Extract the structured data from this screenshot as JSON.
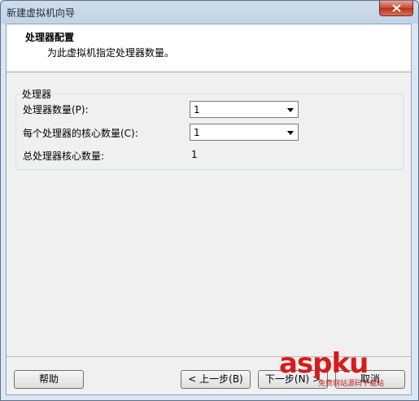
{
  "window": {
    "title": "新建虚拟机向导"
  },
  "header": {
    "title": "处理器配置",
    "subtitle": "为此虚拟机指定处理器数量。"
  },
  "processor_group": {
    "label": "处理器",
    "num_processors_label": "处理器数量(P):",
    "num_processors_value": "1",
    "cores_per_processor_label": "每个处理器的核心数量(C):",
    "cores_per_processor_value": "1",
    "total_cores_label": "总处理器核心数量:",
    "total_cores_value": "1"
  },
  "footer": {
    "help_label": "帮助",
    "back_label": "< 上一步(B)",
    "next_label": "下一步(N) >",
    "cancel_label": "取消"
  },
  "watermark": {
    "text": "aspku",
    "sub": "免费网站源码下载站"
  }
}
